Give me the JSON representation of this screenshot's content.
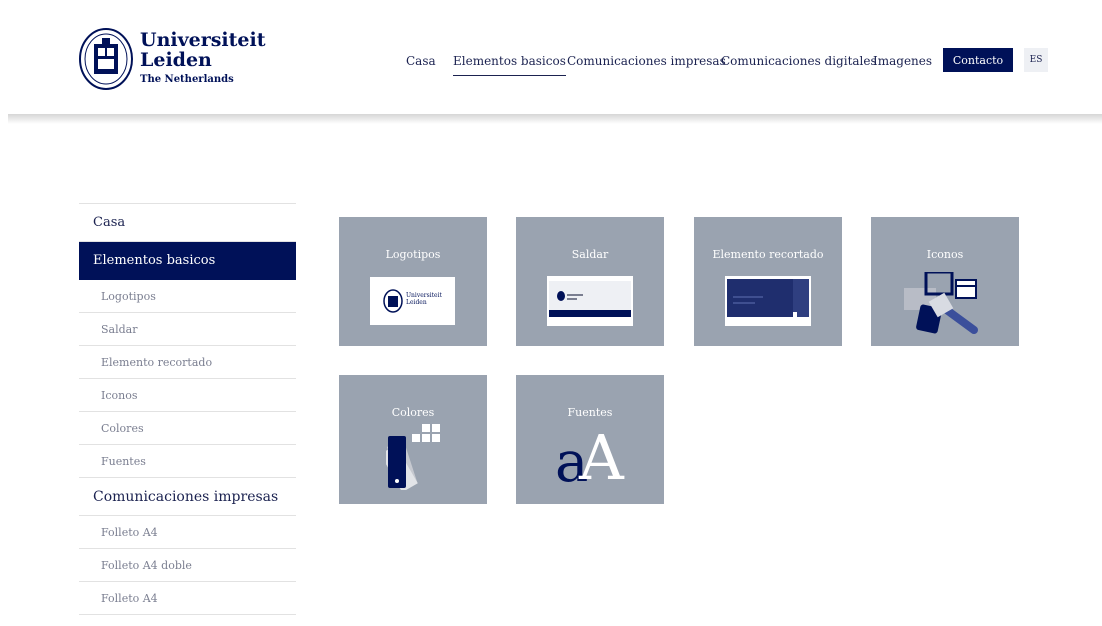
{
  "brand": {
    "line1": "Universiteit",
    "line2": "Leiden",
    "line3": "The Netherlands"
  },
  "nav": {
    "items": [
      "Casa",
      "Elementos basicos",
      "Comunicaciones impresas",
      "Comunicaciones digitales",
      "Imagenes"
    ],
    "active": "Elementos basicos",
    "contact_label": "Contacto",
    "lang_label": "ES"
  },
  "sidebar": {
    "items": [
      {
        "label": "Casa",
        "level": 1
      },
      {
        "label": "Elementos basicos",
        "level": 1,
        "active": true
      },
      {
        "label": "Logotipos",
        "level": 2
      },
      {
        "label": "Saldar",
        "level": 2
      },
      {
        "label": "Elemento recortado",
        "level": 2
      },
      {
        "label": "Iconos",
        "level": 2
      },
      {
        "label": "Colores",
        "level": 2
      },
      {
        "label": "Fuentes",
        "level": 2
      },
      {
        "label": "Comunicaciones impresas",
        "level": 1
      },
      {
        "label": "Folleto A4",
        "level": 2
      },
      {
        "label": "Folleto A4 doble",
        "level": 2
      },
      {
        "label": "Folleto A4",
        "level": 2
      }
    ]
  },
  "tiles": [
    {
      "label": "Logotipos"
    },
    {
      "label": "Saldar"
    },
    {
      "label": "Elemento recortado"
    },
    {
      "label": "Iconos"
    },
    {
      "label": "Colores"
    },
    {
      "label": "Fuentes"
    }
  ],
  "thumbs": {
    "logo_line1": "Universiteit",
    "logo_line2": "Leiden",
    "fuentes_small": "a",
    "fuentes_big": "A"
  },
  "colors": {
    "brand_navy": "#001158",
    "tile_grey": "#9aa3b0"
  }
}
